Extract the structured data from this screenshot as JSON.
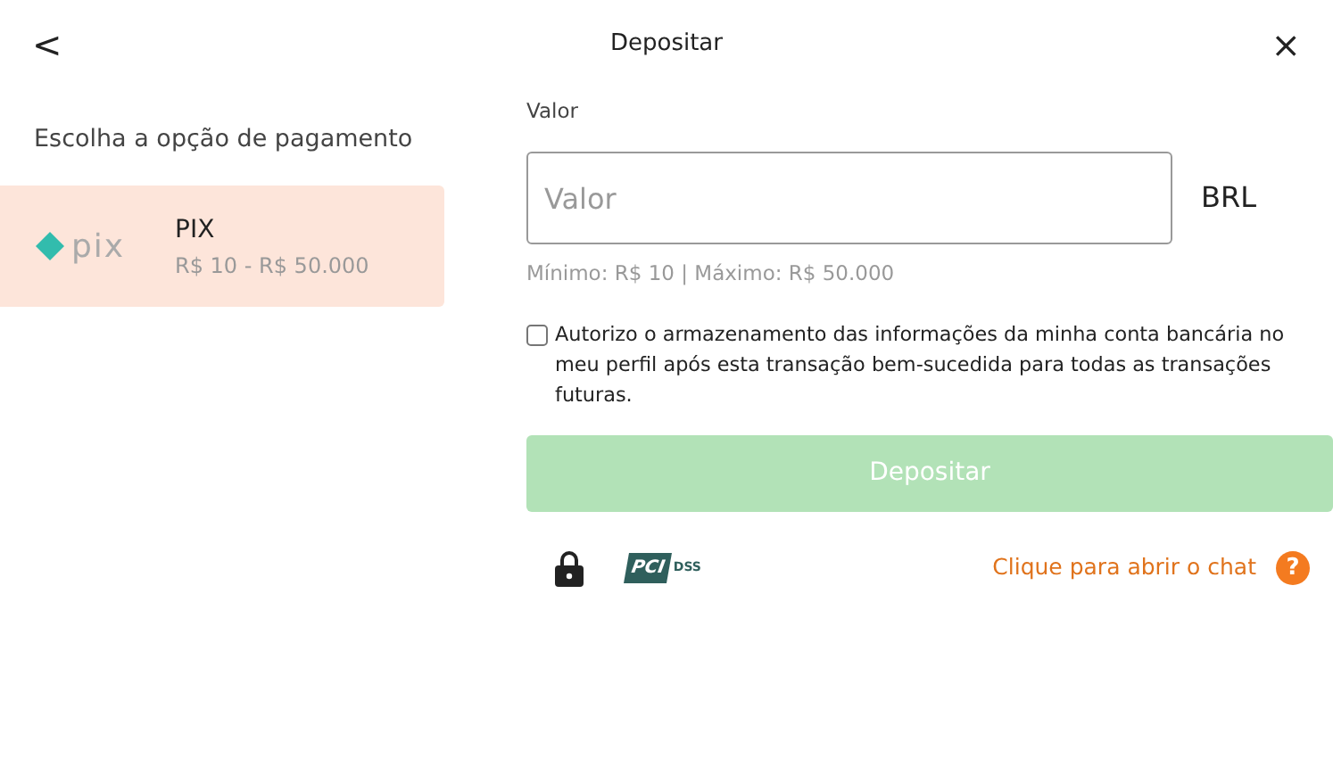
{
  "header": {
    "back": "<",
    "title": "Depositar",
    "close": "×"
  },
  "sidebar": {
    "heading": "Escolha a opção de pagamento",
    "methods": [
      {
        "logo_text": "pix",
        "name": "PIX",
        "range": "R$ 10 - R$ 50.000",
        "selected": true
      }
    ]
  },
  "form": {
    "label": "Valor",
    "placeholder": "Valor",
    "currency": "BRL",
    "limits": "Mínimo: R$ 10 | Máximo: R$ 50.000",
    "consent": {
      "text": "Autorizo o armazenamento das informações da minha conta bancária no meu perfil após esta transação bem-sucedida para todas as transações futuras.",
      "checked": false
    },
    "submit": {
      "label": "Depositar",
      "disabled": true
    }
  },
  "footer": {
    "pci": {
      "left": "PCI",
      "right": "DSS"
    },
    "chat_link": "Clique para abrir o chat",
    "help": "?"
  }
}
